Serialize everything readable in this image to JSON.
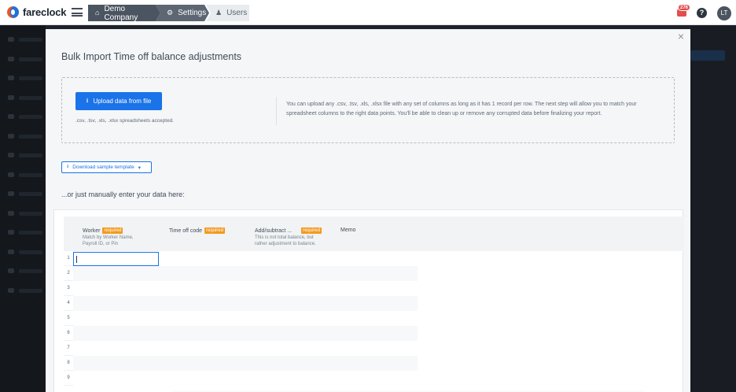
{
  "app": {
    "brand": "fareclock"
  },
  "breadcrumb": [
    {
      "label": "Demo Company",
      "icon": "home-icon"
    },
    {
      "label": "Settings",
      "icon": "gear-icon"
    },
    {
      "label": "Users",
      "icon": "users-icon"
    }
  ],
  "topbar": {
    "notifications_count": "276",
    "help": "?",
    "avatar_initials": "LT"
  },
  "modal": {
    "title": "Bulk Import Time off balance adjustments",
    "upload_label": "Upload data from file",
    "accepted_text": ".csv, .tsv, .xls, .xlsx spreadsheets accepted.",
    "info_text": "You can upload any .csv, .tsv, .xls, .xlsx file with any set of columns as long as it has 1 record per row. The next step will allow you to match your spreadsheet columns to the right data points. You'll be able to clean up or remove any corrupted data before finalizing your report.",
    "sample_label": "Download sample template",
    "manual_text": "...or just manually enter your data here:"
  },
  "grid": {
    "columns": [
      {
        "label": "Worker",
        "required": "required",
        "hint": "Match by Worker Name, Payroll ID, or Pin"
      },
      {
        "label": "Time off code",
        "required": "required",
        "hint": ""
      },
      {
        "label": "Add/subtract ...",
        "required": "required",
        "hint": "This is not total balance, but rather adjustment to balance."
      },
      {
        "label": "Memo",
        "required": "",
        "hint": ""
      }
    ],
    "row_numbers": [
      "1",
      "2",
      "3",
      "4",
      "5",
      "6",
      "7",
      "8",
      "9"
    ]
  },
  "colors": {
    "primary": "#1a73e8",
    "required_badge": "#f29a1f",
    "breadcrumb_dark": "#4b5561"
  }
}
